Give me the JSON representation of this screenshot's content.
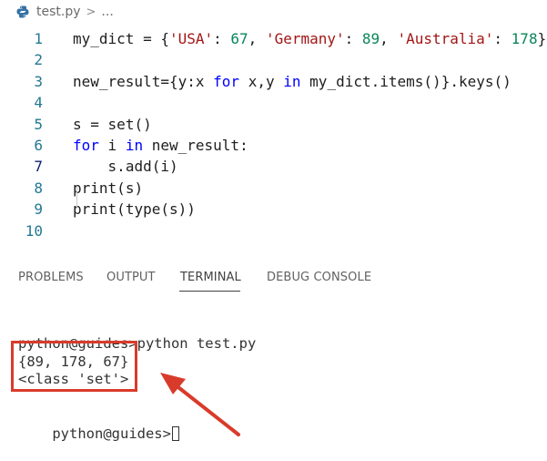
{
  "breadcrumb": {
    "filename": "test.py",
    "separator": ">",
    "more": "..."
  },
  "editor": {
    "lines": [
      {
        "num": "1",
        "code": "my_dict = {'USA': 67, 'Germany': 89, 'Australia': 178}"
      },
      {
        "num": "2",
        "code": ""
      },
      {
        "num": "3",
        "code": "new_result={y:x for x,y in my_dict.items()}.keys()"
      },
      {
        "num": "4",
        "code": ""
      },
      {
        "num": "5",
        "code": "s = set()"
      },
      {
        "num": "6",
        "code": "for i in new_result:"
      },
      {
        "num": "7",
        "code": "    s.add(i)"
      },
      {
        "num": "8",
        "code": "print(s)"
      },
      {
        "num": "9",
        "code": "print(type(s))"
      },
      {
        "num": "10",
        "code": ""
      }
    ],
    "active_line": "7"
  },
  "panel": {
    "tabs": [
      "PROBLEMS",
      "OUTPUT",
      "TERMINAL",
      "DEBUG CONSOLE"
    ],
    "active_tab": "TERMINAL"
  },
  "terminal": {
    "command_line": "python@guides>python test.py",
    "output_1": "{89, 178, 67}",
    "output_2": "<class 'set'>",
    "prompt": "python@guides>"
  },
  "colors": {
    "keyword": "#0000ff",
    "string": "#a31515",
    "number": "#098658",
    "line_number": "#237893",
    "annotation": "#d93b2b"
  }
}
